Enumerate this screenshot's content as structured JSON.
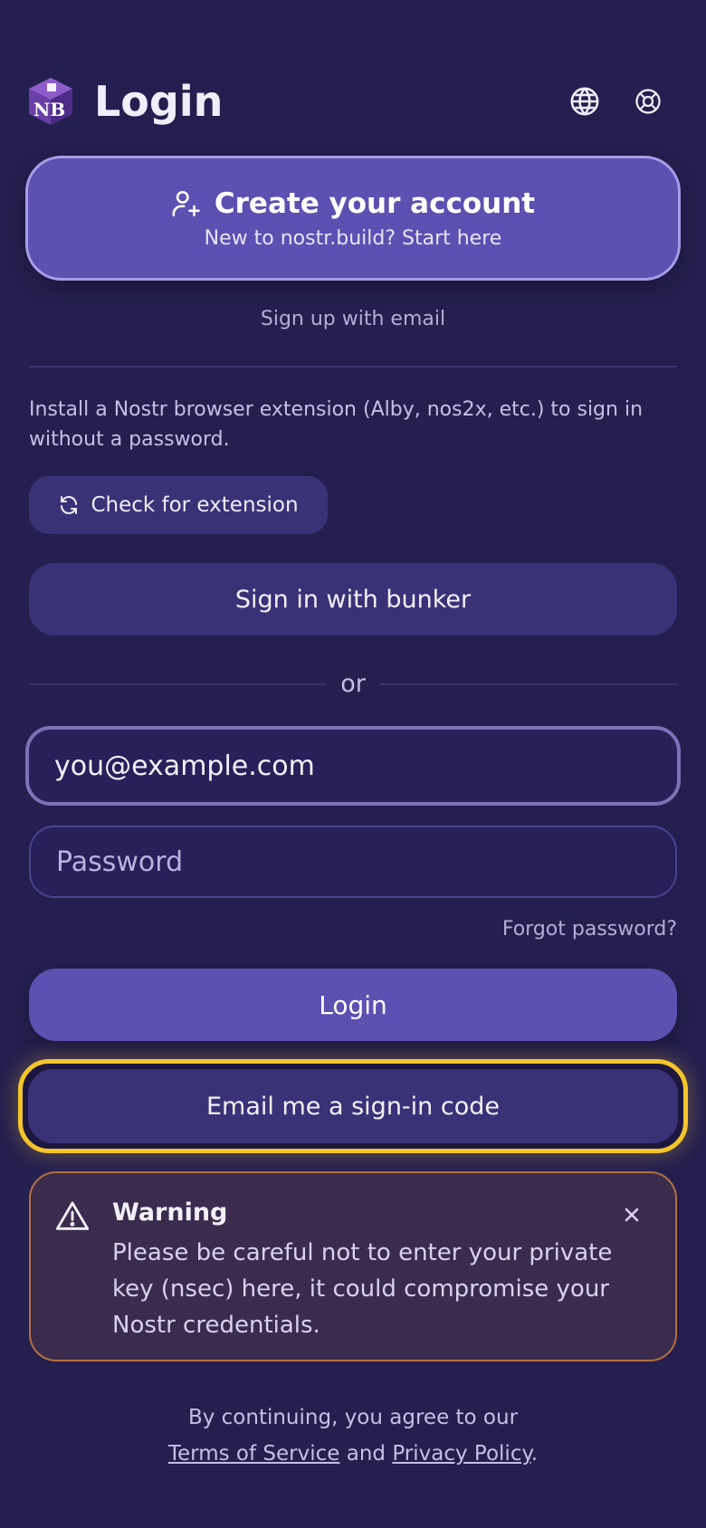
{
  "header": {
    "title": "Login",
    "logo_text": "NB"
  },
  "create_account": {
    "title": "Create your account",
    "subtitle": "New to nostr.build? Start here"
  },
  "signup_email_link": "Sign up with email",
  "extension": {
    "description": "Install a Nostr browser extension (Alby, nos2x, etc.) to sign in without a password.",
    "check_button": "Check for extension"
  },
  "bunker_button": "Sign in with bunker",
  "separator_text": "or",
  "form": {
    "email_value": "you@example.com",
    "password_placeholder": "Password",
    "forgot_link": "Forgot password?",
    "login_button": "Login",
    "email_code_button": "Email me a sign-in code"
  },
  "warning": {
    "title": "Warning",
    "body": "Please be careful not to enter your private key (nsec) here, it could compromise your Nostr credentials."
  },
  "footer": {
    "prefix": "By continuing, you agree to our",
    "terms_link": "Terms of Service",
    "conjunction": "and",
    "privacy_link": "Privacy Policy",
    "suffix": "."
  },
  "colors": {
    "background": "#241f4f",
    "primary": "#5c50b0",
    "secondary": "#3a3276",
    "highlight": "#f4c52b",
    "warning_border": "#b46f3f"
  }
}
